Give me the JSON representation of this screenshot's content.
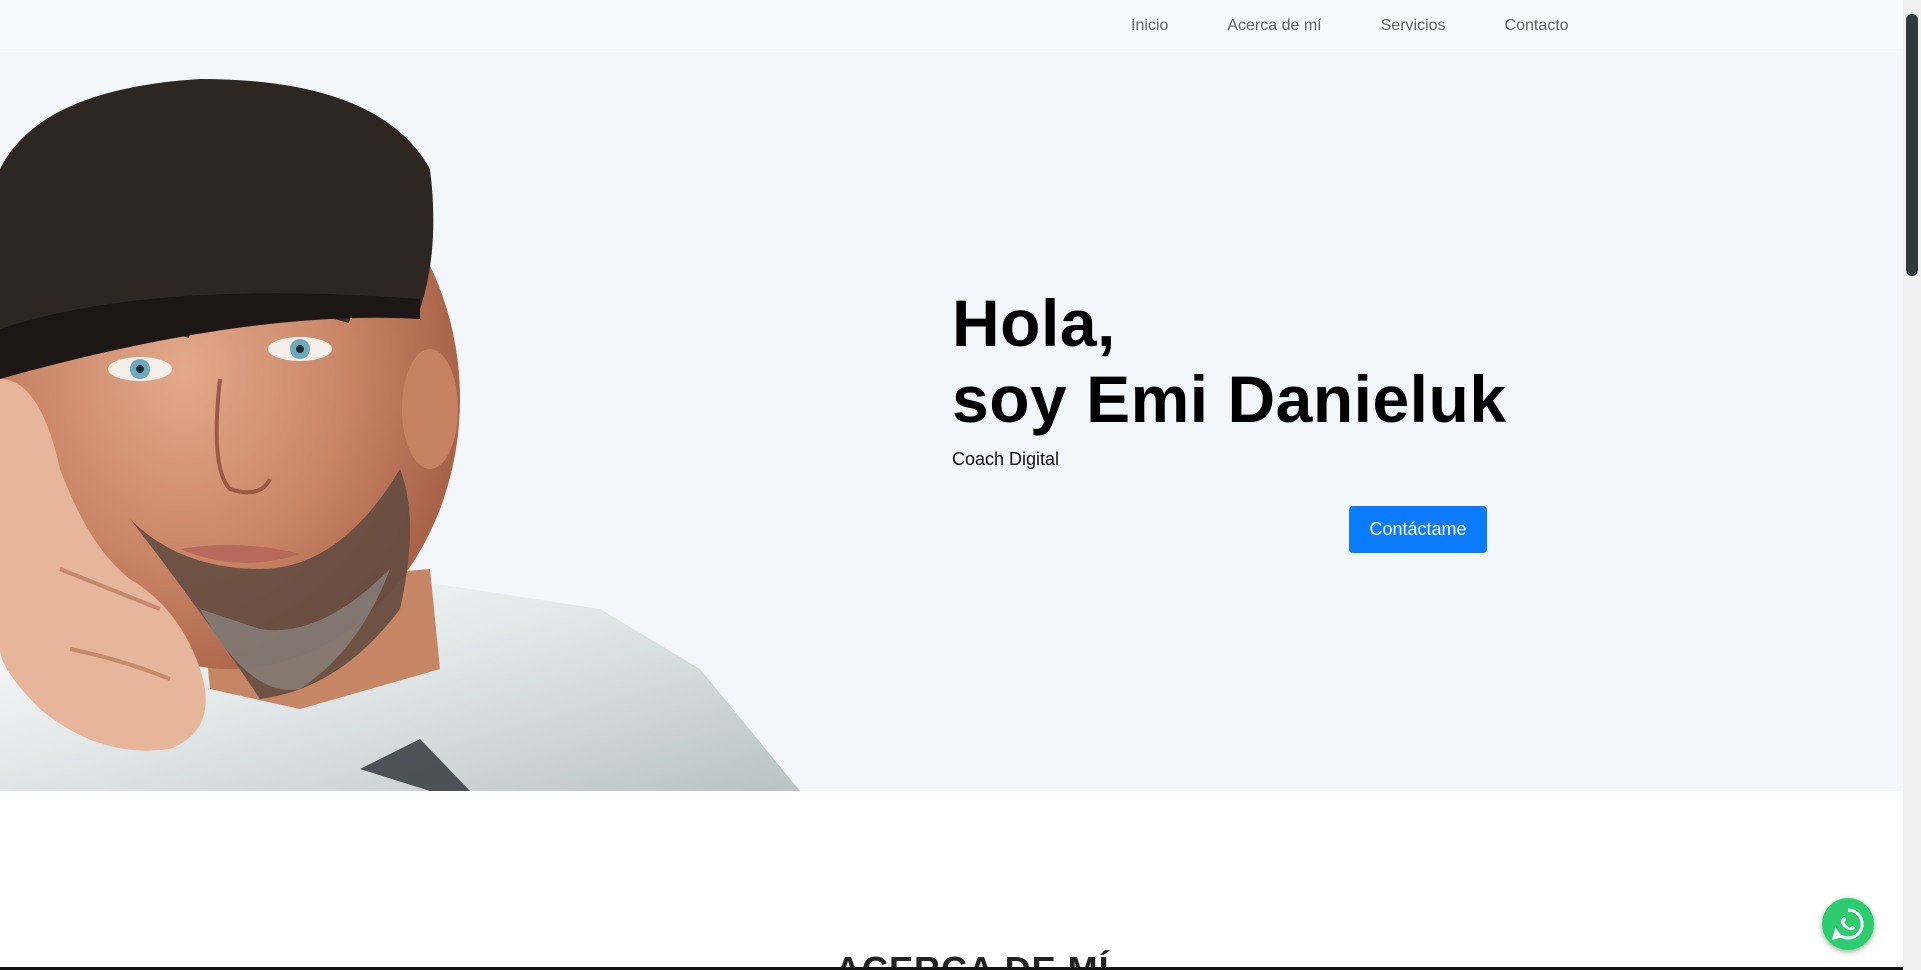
{
  "nav": {
    "items": [
      {
        "label": "Inicio"
      },
      {
        "label": "Acerca de mí"
      },
      {
        "label": "Servicios"
      },
      {
        "label": "Contacto"
      }
    ]
  },
  "hero": {
    "greeting_line1": "Hola,",
    "greeting_line2": "soy Emi Danieluk",
    "subtitle": "Coach Digital",
    "cta_label": "Contáctame"
  },
  "about": {
    "title": "ACERCA DE MÍ"
  },
  "icons": {
    "whatsapp": "whatsapp-icon"
  },
  "colors": {
    "accent": "#0a7bff",
    "hero_bg": "#f3f6fb",
    "whatsapp_green": "#25d366"
  }
}
